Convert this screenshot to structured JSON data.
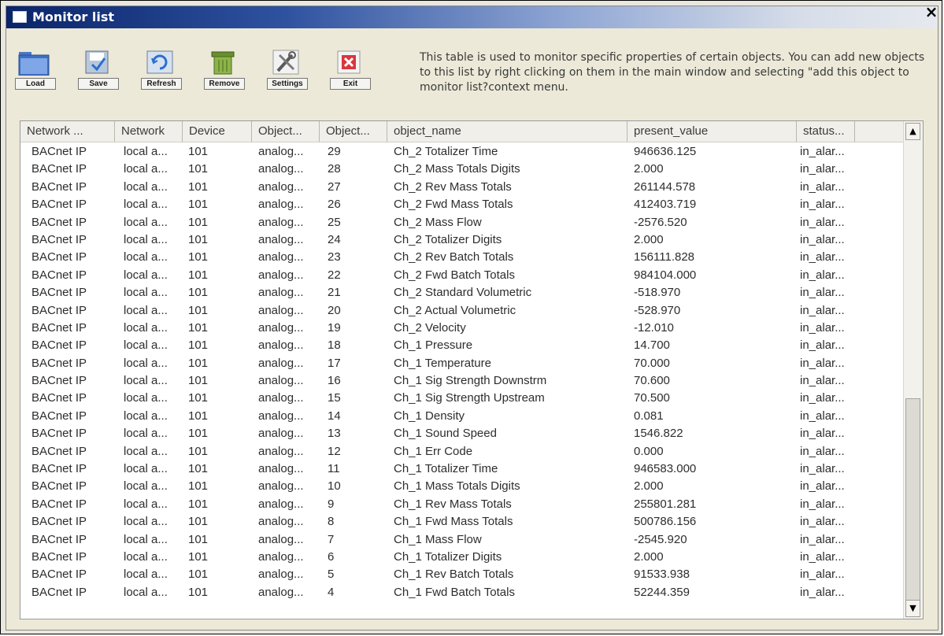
{
  "window": {
    "title": "Monitor list",
    "close_label": "×"
  },
  "toolbar": {
    "buttons": [
      {
        "label": "Load",
        "icon": "folder-icon"
      },
      {
        "label": "Save",
        "icon": "save-icon"
      },
      {
        "label": "Refresh",
        "icon": "refresh-icon"
      },
      {
        "label": "Remove",
        "icon": "trash-icon"
      },
      {
        "label": "Settings",
        "icon": "tools-icon"
      },
      {
        "label": "Exit",
        "icon": "exit-icon"
      }
    ]
  },
  "description": "This table is used to monitor specific properties of certain objects. You can add new objects to this list by right clicking on them in the main window and selecting \"add this object to monitor list?context menu.",
  "table": {
    "columns": [
      "Network ...",
      "Network",
      "Device",
      "Object...",
      "Object...",
      "object_name",
      "present_value",
      "status..."
    ],
    "rows": [
      [
        "BACnet IP",
        "local a...",
        "101",
        "analog...",
        "29",
        "Ch_2 Totalizer Time",
        "946636.125",
        "in_alar..."
      ],
      [
        "BACnet IP",
        "local a...",
        "101",
        "analog...",
        "28",
        "Ch_2 Mass Totals Digits",
        "2.000",
        "in_alar..."
      ],
      [
        "BACnet IP",
        "local a...",
        "101",
        "analog...",
        "27",
        "Ch_2 Rev Mass Totals",
        "261144.578",
        "in_alar..."
      ],
      [
        "BACnet IP",
        "local a...",
        "101",
        "analog...",
        "26",
        "Ch_2 Fwd Mass Totals",
        "412403.719",
        "in_alar..."
      ],
      [
        "BACnet IP",
        "local a...",
        "101",
        "analog...",
        "25",
        "Ch_2 Mass Flow",
        "-2576.520",
        "in_alar..."
      ],
      [
        "BACnet IP",
        "local a...",
        "101",
        "analog...",
        "24",
        "Ch_2 Totalizer Digits",
        "2.000",
        "in_alar..."
      ],
      [
        "BACnet IP",
        "local a...",
        "101",
        "analog...",
        "23",
        "Ch_2 Rev Batch Totals",
        "156111.828",
        "in_alar..."
      ],
      [
        "BACnet IP",
        "local a...",
        "101",
        "analog...",
        "22",
        "Ch_2 Fwd Batch Totals",
        "984104.000",
        "in_alar..."
      ],
      [
        "BACnet IP",
        "local a...",
        "101",
        "analog...",
        "21",
        "Ch_2 Standard Volumetric",
        "-518.970",
        "in_alar..."
      ],
      [
        "BACnet IP",
        "local a...",
        "101",
        "analog...",
        "20",
        "Ch_2 Actual Volumetric",
        "-528.970",
        "in_alar..."
      ],
      [
        "BACnet IP",
        "local a...",
        "101",
        "analog...",
        "19",
        "Ch_2 Velocity",
        "-12.010",
        "in_alar..."
      ],
      [
        "BACnet IP",
        "local a...",
        "101",
        "analog...",
        "18",
        "Ch_1 Pressure",
        "14.700",
        "in_alar..."
      ],
      [
        "BACnet IP",
        "local a...",
        "101",
        "analog...",
        "17",
        "Ch_1 Temperature",
        "70.000",
        "in_alar..."
      ],
      [
        "BACnet IP",
        "local a...",
        "101",
        "analog...",
        "16",
        "Ch_1 Sig Strength Downstrm",
        "70.600",
        "in_alar..."
      ],
      [
        "BACnet IP",
        "local a...",
        "101",
        "analog...",
        "15",
        "Ch_1 Sig Strength Upstream",
        "70.500",
        "in_alar..."
      ],
      [
        "BACnet IP",
        "local a...",
        "101",
        "analog...",
        "14",
        "Ch_1 Density",
        "0.081",
        "in_alar..."
      ],
      [
        "BACnet IP",
        "local a...",
        "101",
        "analog...",
        "13",
        "Ch_1 Sound Speed",
        "1546.822",
        "in_alar..."
      ],
      [
        "BACnet IP",
        "local a...",
        "101",
        "analog...",
        "12",
        "Ch_1 Err Code",
        "0.000",
        "in_alar..."
      ],
      [
        "BACnet IP",
        "local a...",
        "101",
        "analog...",
        "11",
        "Ch_1 Totalizer Time",
        "946583.000",
        "in_alar..."
      ],
      [
        "BACnet IP",
        "local a...",
        "101",
        "analog...",
        "10",
        "Ch_1 Mass Totals Digits",
        "2.000",
        "in_alar..."
      ],
      [
        "BACnet IP",
        "local a...",
        "101",
        "analog...",
        "9",
        "Ch_1 Rev Mass Totals",
        "255801.281",
        "in_alar..."
      ],
      [
        "BACnet IP",
        "local a...",
        "101",
        "analog...",
        "8",
        "Ch_1 Fwd Mass Totals",
        "500786.156",
        "in_alar..."
      ],
      [
        "BACnet IP",
        "local a...",
        "101",
        "analog...",
        "7",
        "Ch_1 Mass Flow",
        "-2545.920",
        "in_alar..."
      ],
      [
        "BACnet IP",
        "local a...",
        "101",
        "analog...",
        "6",
        "Ch_1 Totalizer Digits",
        "2.000",
        "in_alar..."
      ],
      [
        "BACnet IP",
        "local a...",
        "101",
        "analog...",
        "5",
        "Ch_1 Rev Batch Totals",
        "91533.938",
        "in_alar..."
      ],
      [
        "BACnet IP",
        "local a...",
        "101",
        "analog...",
        "4",
        "Ch_1 Fwd Batch Totals",
        "52244.359",
        "in_alar..."
      ]
    ]
  },
  "scrollbar": {
    "up_label": "▲",
    "down_label": "▼"
  }
}
